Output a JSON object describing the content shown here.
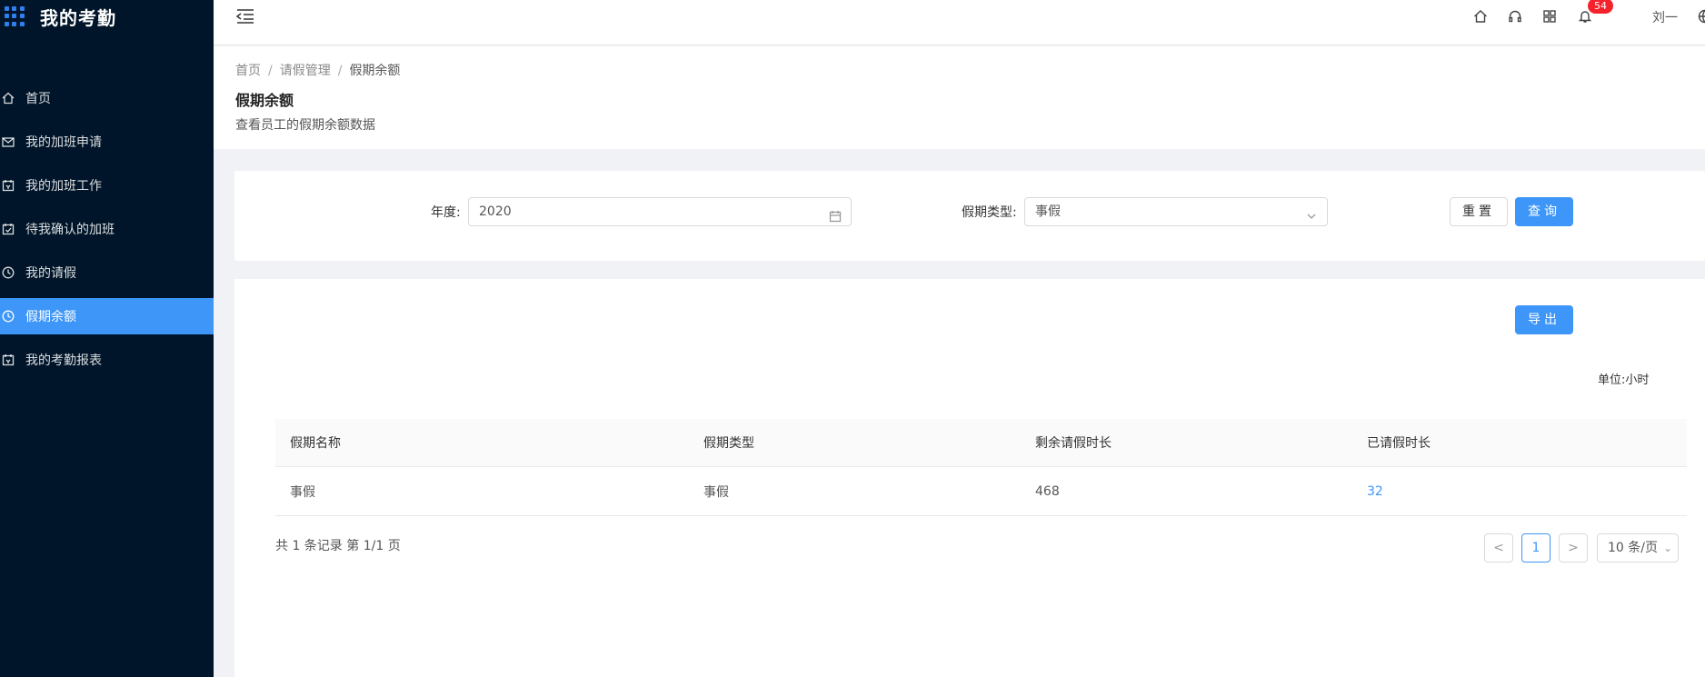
{
  "app": {
    "title": "我的考勤"
  },
  "sidebar": {
    "items": [
      {
        "label": "首页",
        "icon": "home-icon"
      },
      {
        "label": "我的加班申请",
        "icon": "mail-icon"
      },
      {
        "label": "我的加班工作",
        "icon": "calendar-icon"
      },
      {
        "label": "待我确认的加班",
        "icon": "calendar-check-icon"
      },
      {
        "label": "我的请假",
        "icon": "clock-icon"
      },
      {
        "label": "假期余额",
        "icon": "clock-icon",
        "active": true
      },
      {
        "label": "我的考勤报表",
        "icon": "calendar-icon"
      }
    ]
  },
  "header": {
    "notification_count": "54",
    "username": "刘一",
    "icons": [
      "home-icon",
      "headset-icon",
      "apps-icon",
      "bell-icon",
      "globe-icon"
    ]
  },
  "breadcrumb": [
    "首页",
    "请假管理",
    "假期余额"
  ],
  "page": {
    "title": "假期余额",
    "description": "查看员工的假期余额数据"
  },
  "filters": {
    "year_label": "年度:",
    "year_value": "2020",
    "type_label": "假期类型:",
    "type_value": "事假",
    "reset_label": "重置",
    "query_label": "查询"
  },
  "table": {
    "export_label": "导出",
    "unit": "单位:小时",
    "columns": [
      "假期名称",
      "假期类型",
      "剩余请假时长",
      "已请假时长"
    ],
    "rows": [
      [
        "事假",
        "事假",
        "468",
        "32"
      ]
    ]
  },
  "pagination": {
    "summary": "共 1 条记录 第 1/1 页",
    "current_page": "1",
    "page_size": "10 条/页",
    "prev": "<",
    "next": ">"
  },
  "colors": {
    "sidebar_bg": "#001529",
    "accent": "#3e96f8",
    "badge": "#f5222d"
  }
}
